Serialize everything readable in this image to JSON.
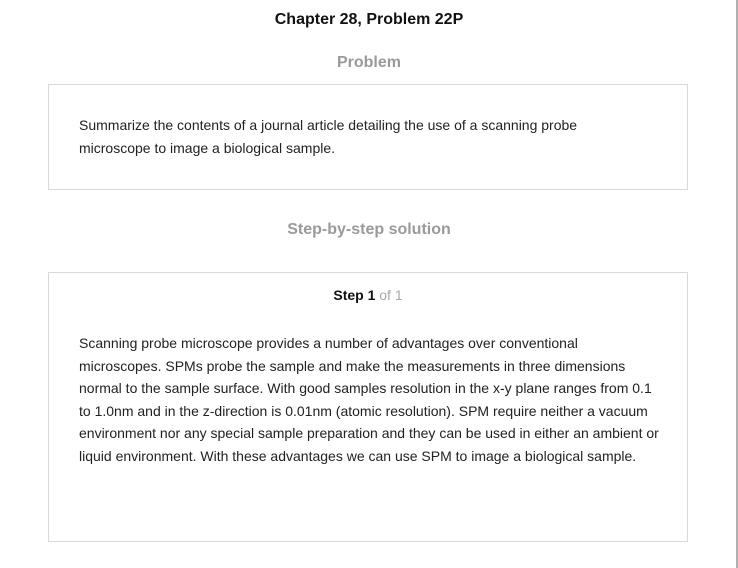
{
  "title": "Chapter 28, Problem 22P",
  "problem": {
    "heading": "Problem",
    "text": "Summarize the contents of a journal article detailing the use of a scanning probe microscope to image a biological sample."
  },
  "solution": {
    "heading": "Step-by-step solution",
    "step": {
      "label": "Step 1",
      "of_text": "of 1"
    },
    "text": "Scanning probe microscope provides a number of advantages over conventional microscopes. SPMs probe the sample and make the measurements in three dimensions normal to the sample surface. With good samples resolution in the x-y plane ranges from 0.1 to 1.0nm and in the z-direction is 0.01nm (atomic resolution). SPM require neither a vacuum environment nor any special sample preparation and they can be used in either an ambient or liquid environment. With these advantages we can use SPM to image a biological sample."
  }
}
